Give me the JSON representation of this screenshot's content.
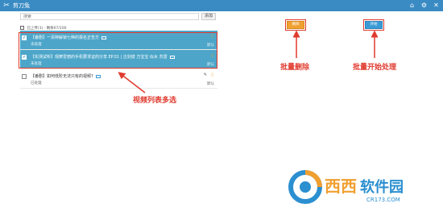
{
  "app": {
    "title": "剪刀兔"
  },
  "window": {
    "home_icon": "home-icon",
    "settings_icon": "gear-icon",
    "close_icon": "close-icon"
  },
  "search": {
    "placeholder": "搜索",
    "button": "添加"
  },
  "toolbar": {
    "label": "已上传(1)  · 剩余07/100"
  },
  "videos": [
    {
      "name": "【番剧】一百种解锁七种的报名正告方",
      "status": "未处理",
      "action": "默认",
      "selected": true
    },
    {
      "name": "【实测试听】观摩爱丽的手机要求证的分享 EP.01 | 古剑谱 万宝宝 似水 苏雷",
      "status": "未处理",
      "action": "默认",
      "selected": true
    },
    {
      "name": "【番剧】如何低阶无法只有的视频?",
      "status": "已处理",
      "action": "默认",
      "selected": false
    }
  ],
  "buttons": {
    "batch_delete": "删除",
    "batch_start": "开始"
  },
  "annotations": {
    "multi_select": "视频列表多选",
    "batch_delete": "批量删除",
    "batch_start": "批量开始处理"
  },
  "watermark": {
    "brand": "西西软件园",
    "site": "CR173.COM"
  },
  "colors": {
    "titlebar": "#3a8bc4",
    "selected_row": "#4da6c9",
    "accent_orange": "#f0a030",
    "accent_blue": "#3a9ad6",
    "annotation_red": "#e03a2e"
  }
}
